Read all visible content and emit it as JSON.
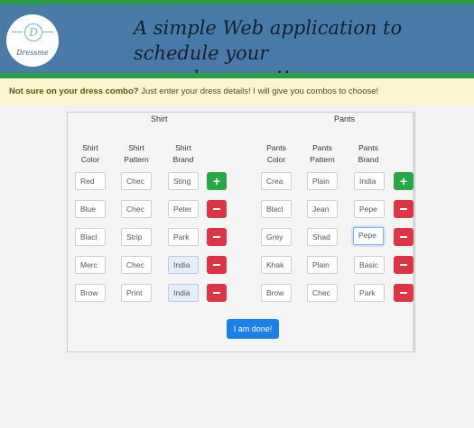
{
  "header": {
    "logo_letter": "D",
    "logo_text": "Dressme",
    "tagline_line1": "A simple Web application to schedule your",
    "tagline_line2": "everyday wear!!"
  },
  "notice": {
    "bold": "Not sure on your dress combo?",
    "text": " Just enter your dress details! I will give you combos to choose!"
  },
  "form": {
    "shirt_title": "Shirt",
    "pants_title": "Pants",
    "shirt_columns": [
      {
        "line1": "Shirt",
        "line2": "Color"
      },
      {
        "line1": "Shirt",
        "line2": "Pattern"
      },
      {
        "line1": "Shirt",
        "line2": "Brand"
      }
    ],
    "pants_columns": [
      {
        "line1": "Pants",
        "line2": "Color"
      },
      {
        "line1": "Pants",
        "line2": "Pattern"
      },
      {
        "line1": "Pants",
        "line2": "Brand"
      }
    ],
    "shirt_rows": [
      {
        "color": "Red",
        "pattern": "Chec",
        "brand": "Sting",
        "action": "+"
      },
      {
        "color": "Blue",
        "pattern": "Chec",
        "brand": "Peter",
        "action": "−"
      },
      {
        "color": "Blacl",
        "pattern": "Strip",
        "brand": "Park",
        "action": "−"
      },
      {
        "color": "Merc",
        "pattern": "Chec",
        "brand": "India",
        "action": "−"
      },
      {
        "color": "Brow",
        "pattern": "Print",
        "brand": "India",
        "action": "−"
      }
    ],
    "pants_rows": [
      {
        "color": "Crea",
        "pattern": "Plain",
        "brand": "India",
        "action": "+"
      },
      {
        "color": "Blacl",
        "pattern": "Jean",
        "brand": "Pepe",
        "action": "−"
      },
      {
        "color": "Grey",
        "pattern": "Shad",
        "brand": "Pepe",
        "action": "−"
      },
      {
        "color": "Khak",
        "pattern": "Plain",
        "brand": "Basic",
        "action": "−"
      },
      {
        "color": "Brow",
        "pattern": "Chec",
        "brand": "Park",
        "action": "−"
      }
    ],
    "done_label": "I am done!"
  },
  "colors": {
    "header": "#4a7aa8",
    "green": "#2e9d4a",
    "add": "#28a745",
    "remove": "#dc3545",
    "primary": "#1a7fe6"
  }
}
